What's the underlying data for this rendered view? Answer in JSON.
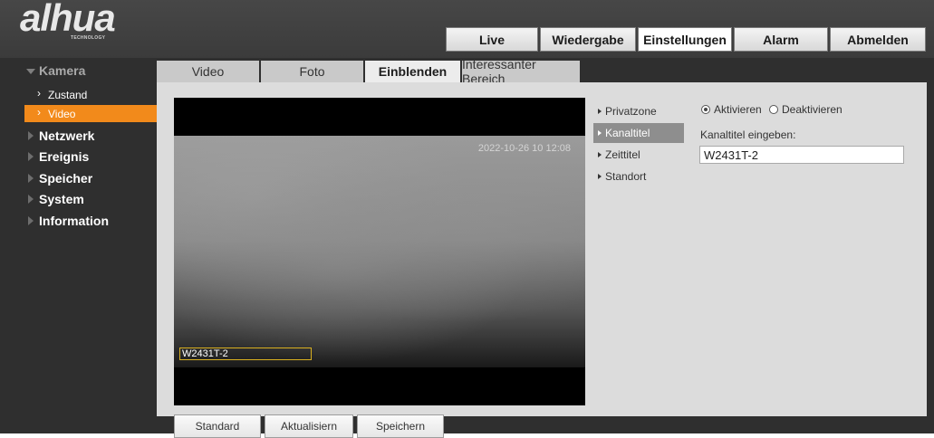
{
  "brand": {
    "logo_text": "alhua",
    "logo_subtext": "TECHNOLOGY"
  },
  "topnav": {
    "live": "Live",
    "playback": "Wiedergabe",
    "settings": "Einstellungen",
    "alarm": "Alarm",
    "logout": "Abmelden"
  },
  "sidebar": {
    "camera": "Kamera",
    "camera_items": [
      "Zustand",
      "Video"
    ],
    "network": "Netzwerk",
    "event": "Ereignis",
    "storage": "Speicher",
    "system": "System",
    "information": "Information"
  },
  "tabs": [
    "Video",
    "Foto",
    "Einblenden",
    "Interessanter Bereich"
  ],
  "preview": {
    "timestamp": "2022-10-26 10 12:08",
    "osd_title": "W2431T-2"
  },
  "buttons": {
    "default": "Standard",
    "refresh": "Aktualisiern",
    "save": "Speichern"
  },
  "overlay_options": [
    "Privatzone",
    "Kanaltitel",
    "Zeittitel",
    "Standort"
  ],
  "settings": {
    "enable": "Aktivieren",
    "disable": "Deaktivieren",
    "title_label": "Kanaltitel eingeben:",
    "title_value": "W2431T-2"
  },
  "colors": {
    "accent": "#f28a1b",
    "selected_option": "#8e8e8e"
  }
}
